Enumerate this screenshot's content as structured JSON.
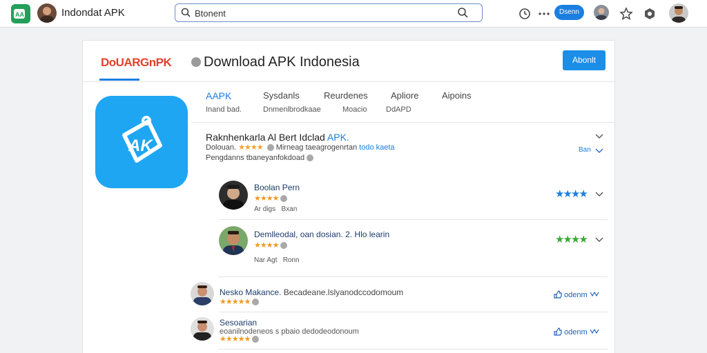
{
  "topbar": {
    "app_title": "Indondat APK",
    "search_value": "Btonent",
    "pill_label": "Dsenn"
  },
  "card": {
    "brand": "DoUARGnPK",
    "title": "Download APK Indonesia",
    "header_button": "Abonlt",
    "tabs": [
      {
        "label": "AAPK",
        "sub": "Inand bad."
      },
      {
        "label": "Sysdanls",
        "sub": "Dnmenlbrodkaae"
      },
      {
        "label": "Reurdenes",
        "sub": "Moacio"
      },
      {
        "label": "Apliore",
        "sub": "DdAPD"
      },
      {
        "label": "Aipoins",
        "sub": ""
      }
    ],
    "app": {
      "name_prefix": "Raknhenkarla Al Bert Idclad ",
      "name_highlight": "APK.",
      "meta_prefix": "Dolouan.",
      "meta_stars": "★★★★",
      "meta_text": "Mirneag taeagrogenrtan",
      "meta_link": "todo kaeta",
      "description": "Pengdanns tbaneyanfokdoad",
      "side_label": "Ban"
    },
    "reviews": [
      {
        "name": "Boolan Pern",
        "stars": "★★★★",
        "meta_a": "Ar digs",
        "meta_b": "Bxan",
        "rating": "★★★★",
        "rating_color": "#1b7fe0"
      },
      {
        "name": "Demlleodal, oan dosian. 2. Hlo learin",
        "stars": "★★★★",
        "meta_a": "Nar Agt",
        "meta_b": "Ronn",
        "rating": "★★★★",
        "rating_color": "#3aa935"
      },
      {
        "name": "Nesko Makance.",
        "comment": "Becadeane.lslyanodccodomoum",
        "stars": "★★★★★",
        "action": "odenm"
      },
      {
        "name": "Sesoarian",
        "comment": "eoanilnodeneos s pbaio dedodeodonoum",
        "stars": "★★★★★",
        "action": "odenm"
      }
    ]
  }
}
